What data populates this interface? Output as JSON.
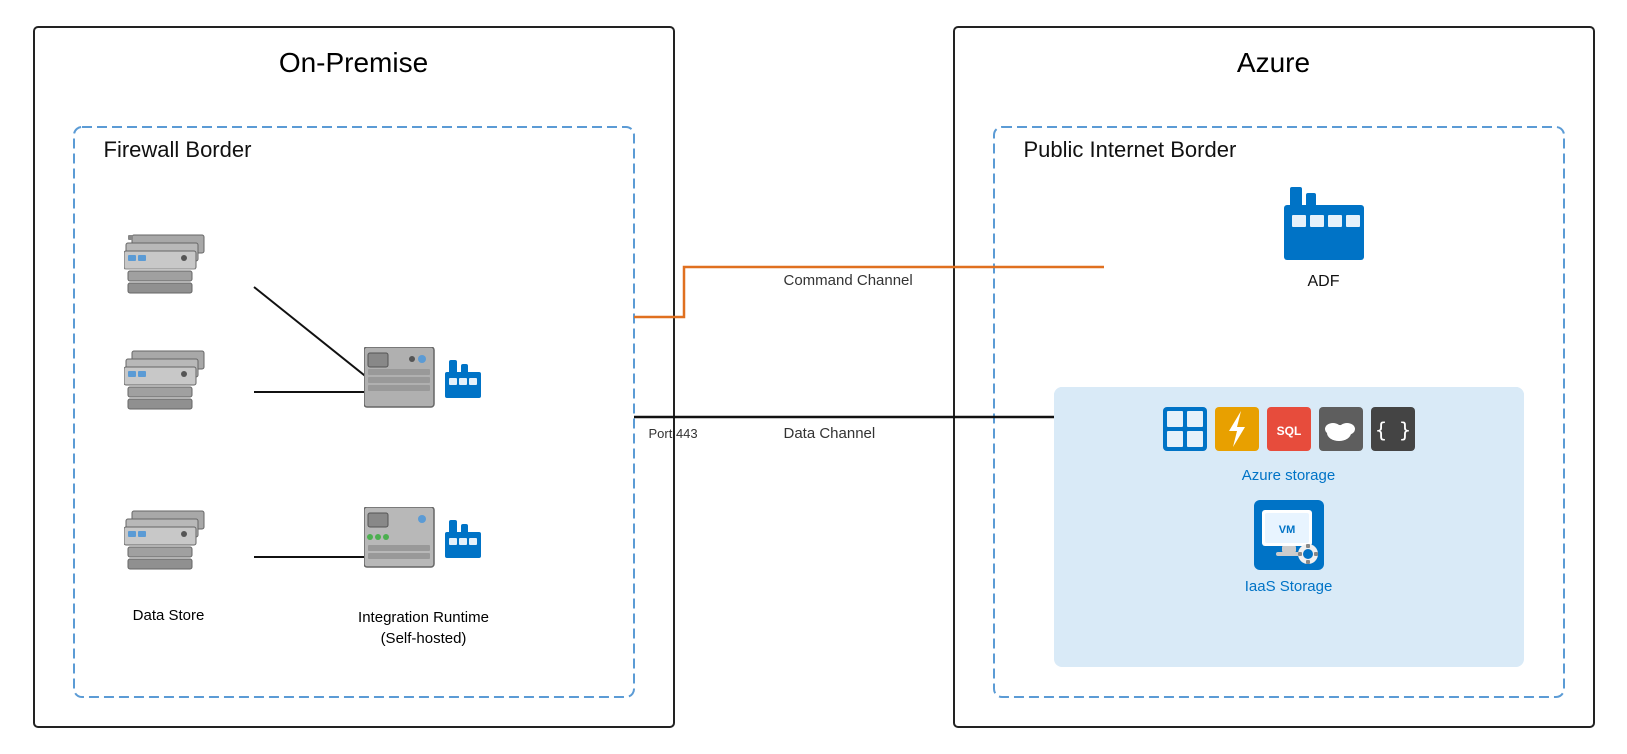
{
  "diagram": {
    "on_premise": {
      "outer_title": "On-Premise",
      "inner_title": "Firewall Border",
      "data_store_label": "Data Store",
      "ir_label": "Integration Runtime\n(Self-hosted)"
    },
    "azure": {
      "outer_title": "Azure",
      "inner_title": "Public Internet Border",
      "adf_label": "ADF",
      "azure_storage_label": "Azure storage",
      "iaas_label": "IaaS Storage"
    },
    "connections": {
      "command_channel": "Command Channel",
      "data_channel": "Data Channel",
      "port_label": "Port 443"
    }
  }
}
